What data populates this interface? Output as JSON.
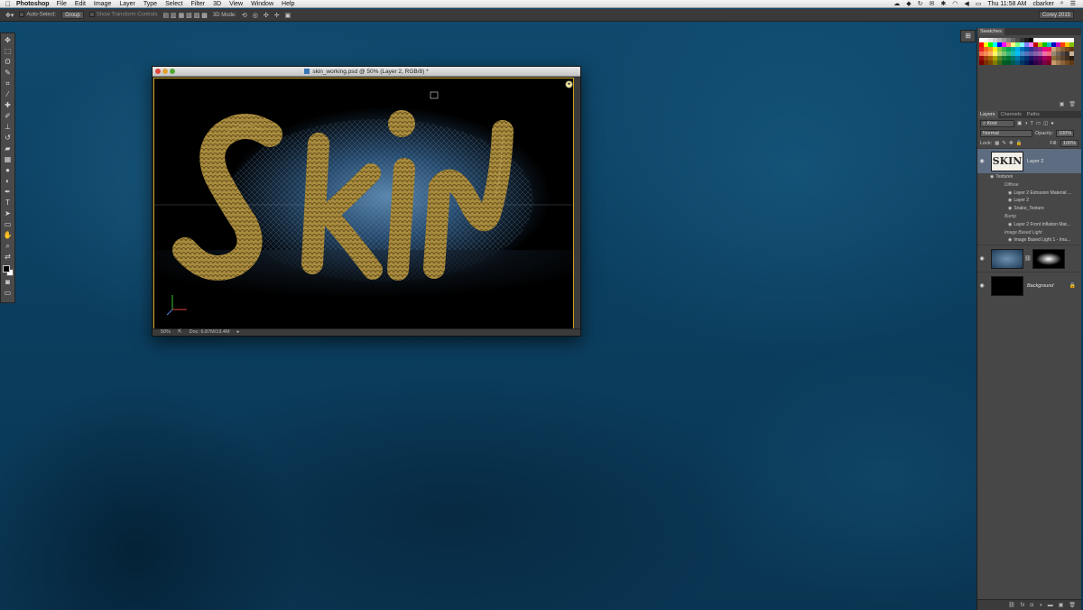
{
  "menubar": {
    "apple_icon": "apple-icon",
    "app_name": "Photoshop",
    "menus": [
      "File",
      "Edit",
      "Image",
      "Layer",
      "Type",
      "Select",
      "Filter",
      "3D",
      "View",
      "Window",
      "Help"
    ],
    "clock": "Thu 11:58 AM",
    "user": "cbarker"
  },
  "options": {
    "auto_select": "Auto-Select:",
    "auto_select_value": "Group",
    "show_transform": "Show Transform Controls",
    "mode_3d": "3D Mode:",
    "workspace": "Corey 2015"
  },
  "document": {
    "title": "skin_working.psd @ 50% (Layer 2, RGB/8) *",
    "zoom": "50%",
    "doc_size": "Doc: 6.87M/19.4M",
    "artwork_text": "SKIN"
  },
  "swatches": {
    "tab": "Swatches",
    "colors": [
      "#ffffff",
      "#f2f2f2",
      "#e0e0e0",
      "#cccccc",
      "#b3b3b3",
      "#999999",
      "#808080",
      "#666666",
      "#4d4d4d",
      "#333333",
      "#1a1a1a",
      "#000000",
      "#ffffff",
      "#ffffff",
      "#ffffff",
      "#ffffff",
      "#ffffff",
      "#ffffff",
      "#ffffff",
      "#ffffff",
      "#ffffff",
      "#ff0000",
      "#ffff00",
      "#00ff00",
      "#00ffff",
      "#0000ff",
      "#ff00ff",
      "#ff8080",
      "#ffff80",
      "#80ff80",
      "#80ffff",
      "#8080ff",
      "#ff80ff",
      "#c00000",
      "#c0c000",
      "#00c000",
      "#00c0c0",
      "#0000c0",
      "#c000c0",
      "#ff4000",
      "#ffc000",
      "#80c000",
      "#ee1d24",
      "#f26522",
      "#f7941d",
      "#fff200",
      "#8dc63f",
      "#39b54a",
      "#00a651",
      "#00a99d",
      "#00aeef",
      "#0072bc",
      "#0054a6",
      "#2e3192",
      "#662d91",
      "#92278f",
      "#ec008c",
      "#ed145b",
      "#c4a87a",
      "#a67c52",
      "#8c6239",
      "#754c24",
      "#603913",
      "#f26c4f",
      "#f68e56",
      "#fbaf5d",
      "#fff568",
      "#acd373",
      "#7cc576",
      "#3bb878",
      "#1abbb4",
      "#00bff3",
      "#438ccb",
      "#5574b9",
      "#605ca8",
      "#855fa8",
      "#a763a8",
      "#f06eaa",
      "#f26d7d",
      "#998675",
      "#736357",
      "#534741",
      "#362f2d",
      "#c7b299",
      "#9e0b0f",
      "#a0410d",
      "#a36209",
      "#aba000",
      "#598527",
      "#1a7b30",
      "#007236",
      "#00746b",
      "#0076a3",
      "#004b80",
      "#003471",
      "#1b1464",
      "#440e62",
      "#630460",
      "#9e005d",
      "#9e0039",
      "#8a6d3b",
      "#6f5a3e",
      "#5a4530",
      "#3f2e1e",
      "#2a1d12",
      "#790000",
      "#7b2e00",
      "#7d4900",
      "#827b00",
      "#406618",
      "#005e20",
      "#005826",
      "#005952",
      "#005b7f",
      "#003663",
      "#002157",
      "#0d004c",
      "#32004b",
      "#4b0049",
      "#7b0046",
      "#7a0026",
      "#c69c6d",
      "#a67c52",
      "#8c6239",
      "#754c24",
      "#603913"
    ]
  },
  "layers_panel": {
    "tabs": [
      "Layers",
      "Channels",
      "Paths"
    ],
    "filter_kind": "Kind",
    "blend_mode": "Normal",
    "opacity_label": "Opacity:",
    "opacity_value": "100%",
    "lock_label": "Lock:",
    "fill_label": "Fill:",
    "fill_value": "100%",
    "layer2": {
      "name": "Layer 2",
      "thumb_text": "SKIN",
      "textures_label": "Textures",
      "diffuse_label": "Diffuse",
      "fx1": "Layer 2 Extrusion Material ...",
      "fx2": "Layer 2",
      "fx3": "Snake_Texture",
      "bump_label": "Bump",
      "fx4": "Layer 2 Front Inflation Mat...",
      "ibl_label": "Image Based Light",
      "fx5": "Image Based Light 1 - Ima..."
    },
    "background_name": "Background"
  }
}
